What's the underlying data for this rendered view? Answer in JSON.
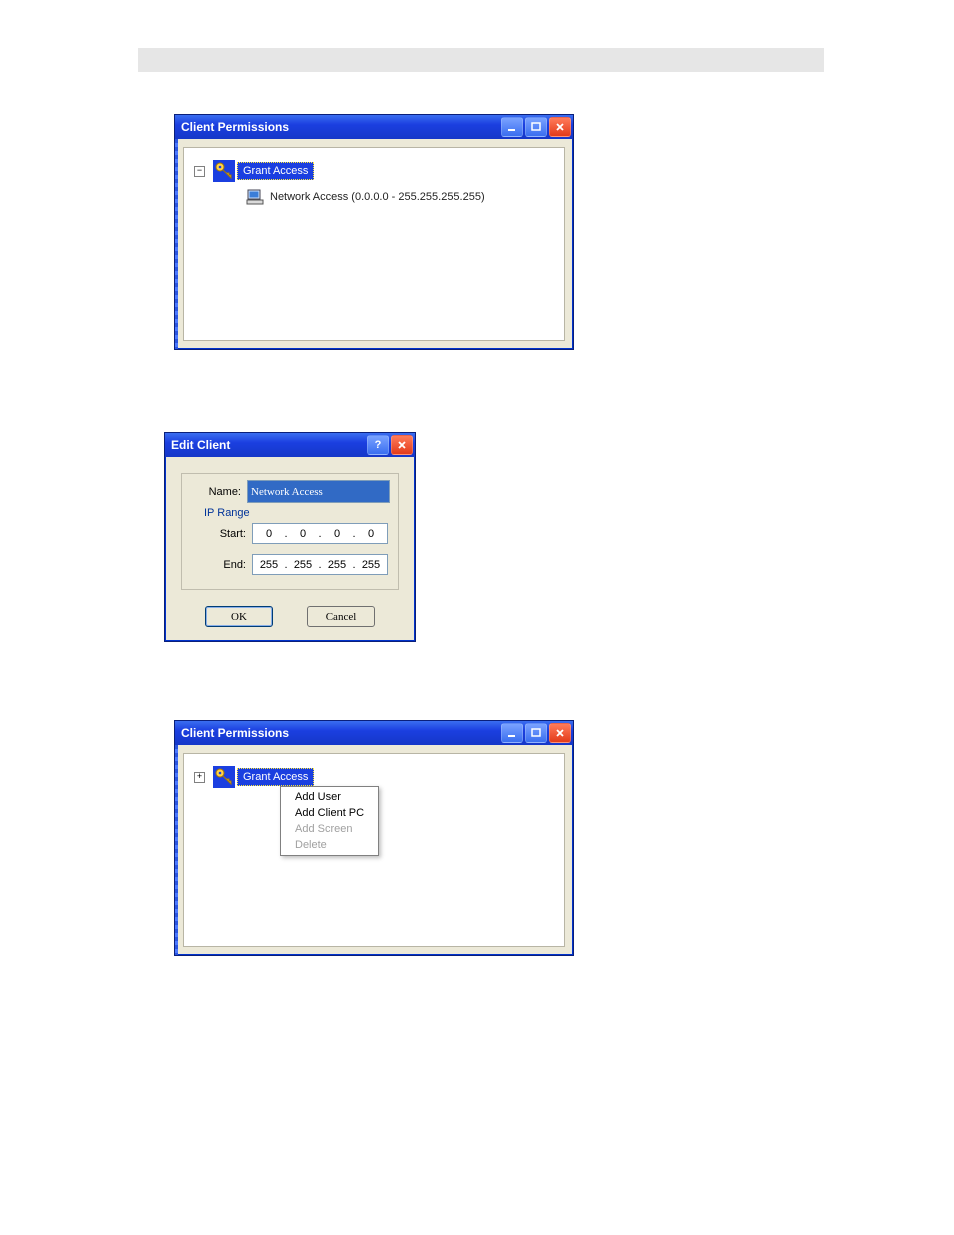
{
  "window1": {
    "title": "Client Permissions",
    "tree_toggle": "−",
    "root_label": "Grant Access",
    "child_label": "Network Access (0.0.0.0 - 255.255.255.255)"
  },
  "window2": {
    "title": "Edit Client",
    "name_label": "Name:",
    "name_value": "Network Access",
    "group_label": "IP Range",
    "start_label": "Start:",
    "end_label": "End:",
    "start_ip": {
      "a": "0",
      "b": "0",
      "c": "0",
      "d": "0"
    },
    "end_ip": {
      "a": "255",
      "b": "255",
      "c": "255",
      "d": "255"
    },
    "ok_label": "OK",
    "cancel_label": "Cancel"
  },
  "window3": {
    "title": "Client Permissions",
    "tree_toggle": "+",
    "root_label": "Grant Access",
    "menu": {
      "add_user": "Add User",
      "add_client_pc": "Add Client PC",
      "add_screen": "Add Screen",
      "delete": "Delete"
    }
  }
}
